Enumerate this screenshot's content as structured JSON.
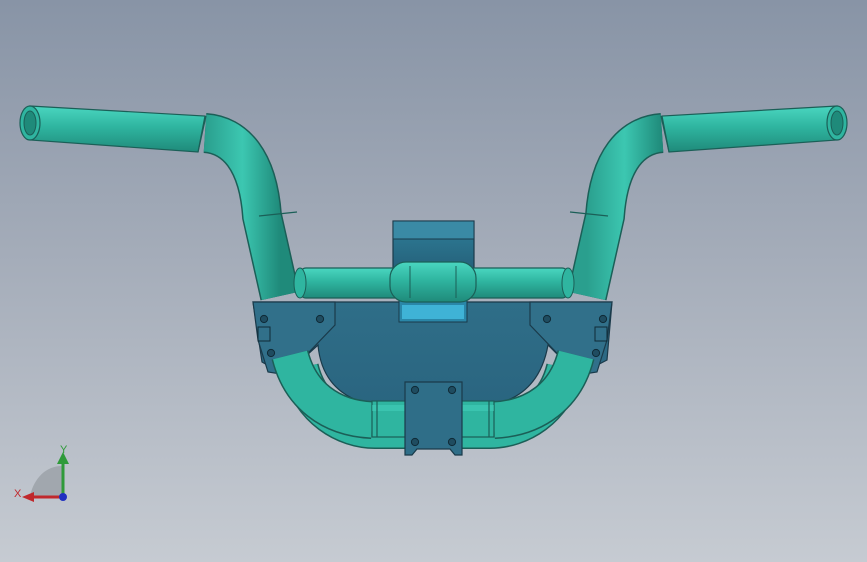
{
  "viewport": {
    "background_top": "#8894a6",
    "background_bottom": "#c6cbd2"
  },
  "model": {
    "tube_color": "#2fb5a0",
    "tube_edge_color": "#1b5f57",
    "plate_color": "#2f6b85",
    "plate_edge_color": "#1a3a4a"
  },
  "triad": {
    "x_label": "X",
    "y_label": "Y",
    "x_color": "#c0282c",
    "y_color": "#2f9a3a",
    "z_color": "#2030c0"
  }
}
